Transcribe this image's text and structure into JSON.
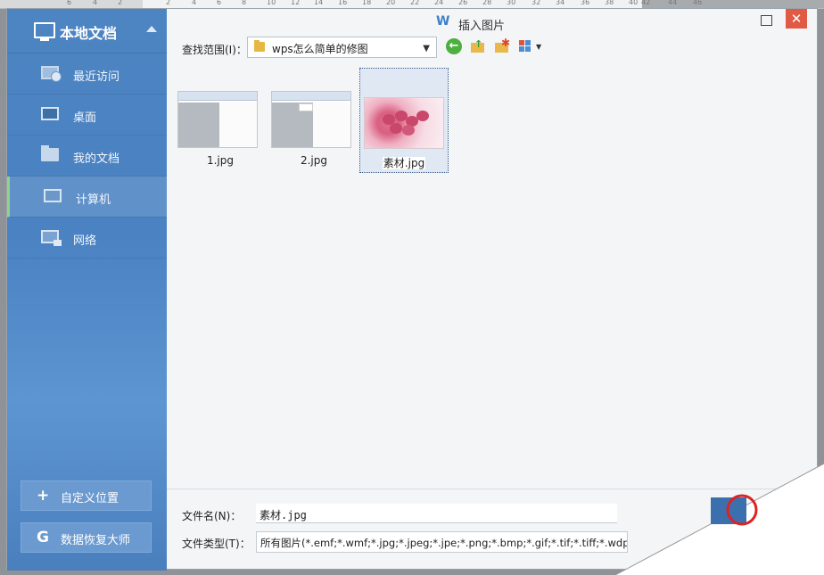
{
  "ruler": {
    "numbers": [
      "6",
      "4",
      "2",
      "2",
      "4",
      "6",
      "8",
      "10",
      "12",
      "14",
      "16",
      "18",
      "20",
      "22",
      "24",
      "26",
      "28",
      "30",
      "32",
      "34",
      "36",
      "38",
      "40",
      "42",
      "44",
      "46"
    ]
  },
  "dialog": {
    "logo_glyph": "W",
    "title": "插入图片"
  },
  "sidebar": {
    "header_title": "本地文档",
    "items": [
      {
        "label": "最近访问",
        "icon": "recent-icon"
      },
      {
        "label": "桌面",
        "icon": "desktop-icon"
      },
      {
        "label": "我的文档",
        "icon": "folder-icon"
      },
      {
        "label": "计算机",
        "icon": "computer-icon",
        "active": true
      },
      {
        "label": "网络",
        "icon": "network-icon"
      }
    ],
    "custom_location_label": "自定义位置",
    "custom_location_glyph": "+",
    "data_recovery_label": "数据恢复大师",
    "data_recovery_glyph": "G"
  },
  "toolbar": {
    "look_in_label": "查找范围(I)：",
    "look_in_value": "wps怎么简单的修图"
  },
  "files": [
    {
      "name": "1.jpg",
      "selected": false
    },
    {
      "name": "2.jpg",
      "selected": false
    },
    {
      "name": "素材.jpg",
      "selected": true
    }
  ],
  "footer": {
    "filename_label": "文件名(N)：",
    "filename_value": "素材.jpg",
    "filetype_label": "文件类型(T)：",
    "filetype_value": "所有图片(*.emf;*.wmf;*.jpg;*.jpeg;*.jpe;*.png;*.bmp;*.gif;*.tif;*.tiff;*.wdp)"
  },
  "colors": {
    "sidebar_blue": "#4d84c2",
    "active_marker": "#8fd48a",
    "close_button": "#e05a44",
    "back_button": "#4caf3e"
  }
}
